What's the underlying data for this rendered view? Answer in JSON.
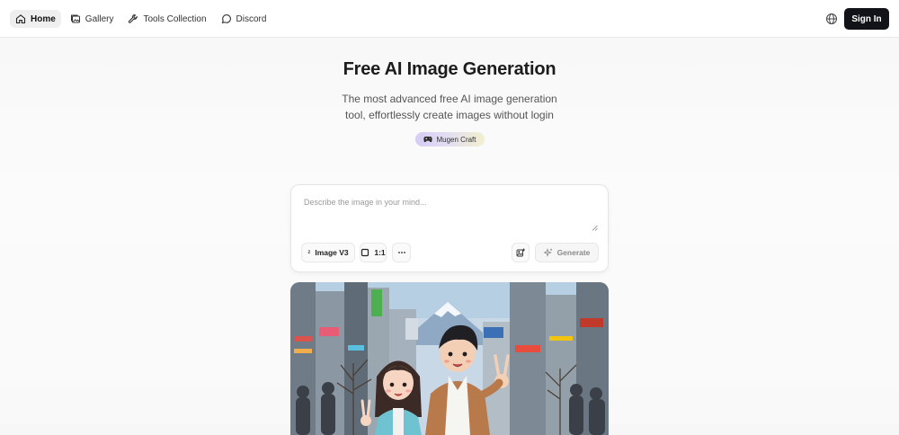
{
  "nav": {
    "items": [
      {
        "label": "Home",
        "icon": "home-icon",
        "active": true
      },
      {
        "label": "Gallery",
        "icon": "gallery-icon",
        "active": false
      },
      {
        "label": "Tools Collection",
        "icon": "wrench-icon",
        "active": false
      },
      {
        "label": "Discord",
        "icon": "chat-bubble-icon",
        "active": false
      }
    ],
    "language_icon": "globe-icon",
    "signin_label": "Sign In"
  },
  "hero": {
    "title": "Free AI Image Generation",
    "subtitle": "The most advanced free AI image generation tool, effortlessly create images without login",
    "badge_label": "Mugen Craft",
    "badge_icon": "gamepad-icon"
  },
  "prompt_card": {
    "placeholder": "Describe the image in your mind...",
    "value": "",
    "model_label": "Image V3",
    "model_glyph": "z",
    "ratio_label": "1:1",
    "more_label": "···",
    "generate_label": "Generate"
  },
  "preview": {
    "icon": "example-image",
    "sky_color": "#a9c6de",
    "accent": "#111318"
  }
}
